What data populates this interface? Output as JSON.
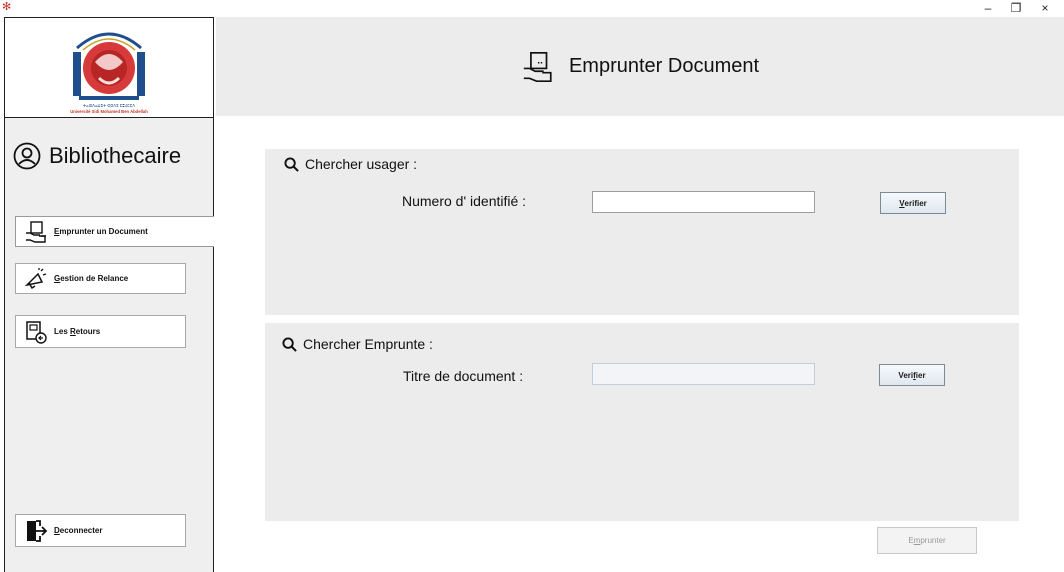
{
  "window": {
    "minimize": "–",
    "restore": "❐",
    "close": "×"
  },
  "sidebar": {
    "logo_caption": "Université Sidi Mohamed Ben Abdellah",
    "role": "Bibliothecaire",
    "items": [
      {
        "label_first": "E",
        "label_rest": "mprunter un Document"
      },
      {
        "label_first": "G",
        "label_rest": "estion de Relance"
      },
      {
        "label_pre": "Les ",
        "label_first": "R",
        "label_rest": "etours"
      }
    ],
    "logout": {
      "label_first": "D",
      "label_rest": "econnecter"
    }
  },
  "header": {
    "title": "Emprunter Document"
  },
  "usager": {
    "title": "Chercher usager :",
    "label": "Numero d' identifié :",
    "value": "",
    "button_first": "V",
    "button_rest": "erifier"
  },
  "emprunte": {
    "title": "Chercher Emprunte :",
    "label": "Titre de document :",
    "value": "",
    "button_pre": "Veri",
    "button_first": "f",
    "button_rest": "ier"
  },
  "footer": {
    "button_pre": "E",
    "button_first": "m",
    "button_rest": "prunter"
  }
}
